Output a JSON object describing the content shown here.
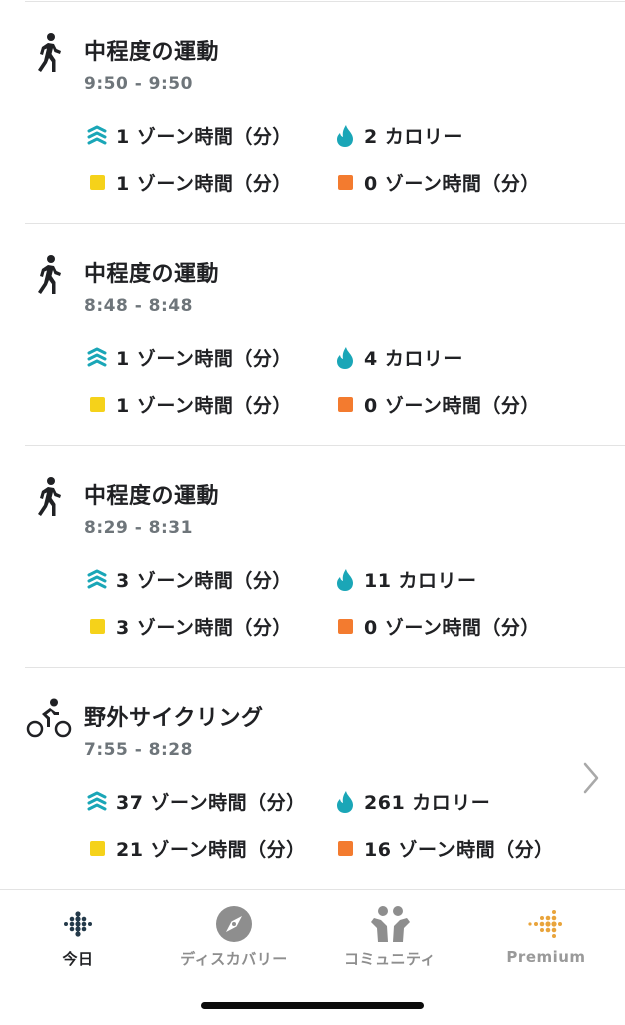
{
  "activities": [
    {
      "icon": "walking-icon",
      "title": "中程度の運動",
      "time": "9:50 - 9:50",
      "zone_minutes": "1 ゾーン時間（分）",
      "calories": "2 カロリー",
      "fat_burn_minutes": "1 ゾーン時間（分）",
      "cardio_minutes": "0 ゾーン時間（分）"
    },
    {
      "icon": "walking-icon",
      "title": "中程度の運動",
      "time": "8:48 - 8:48",
      "zone_minutes": "1 ゾーン時間（分）",
      "calories": "4 カロリー",
      "fat_burn_minutes": "1 ゾーン時間（分）",
      "cardio_minutes": "0 ゾーン時間（分）"
    },
    {
      "icon": "walking-icon",
      "title": "中程度の運動",
      "time": "8:29 - 8:31",
      "zone_minutes": "3 ゾーン時間（分）",
      "calories": "11 カロリー",
      "fat_burn_minutes": "3 ゾーン時間（分）",
      "cardio_minutes": "0 ゾーン時間（分）"
    },
    {
      "icon": "cycling-icon",
      "title": "野外サイクリング",
      "time": "7:55 - 8:28",
      "zone_minutes": "37 ゾーン時間（分）",
      "calories": "261 カロリー",
      "fat_burn_minutes": "21 ゾーン時間（分）",
      "cardio_minutes": "16 ゾーン時間（分）"
    }
  ],
  "colors": {
    "teal": "#1aa6b7",
    "fat_burn_yellow": "#f5d21a",
    "cardio_orange": "#f37b2f",
    "premium_gold": "#e9a43b"
  },
  "tabbar": {
    "tabs": [
      {
        "label": "今日",
        "icon": "fitbit-dots-icon",
        "active": true
      },
      {
        "label": "ディスカバリー",
        "icon": "compass-icon",
        "active": false
      },
      {
        "label": "コミュニティ",
        "icon": "community-icon",
        "active": false
      },
      {
        "label": "Premium",
        "icon": "premium-dots-icon",
        "active": false
      }
    ]
  }
}
